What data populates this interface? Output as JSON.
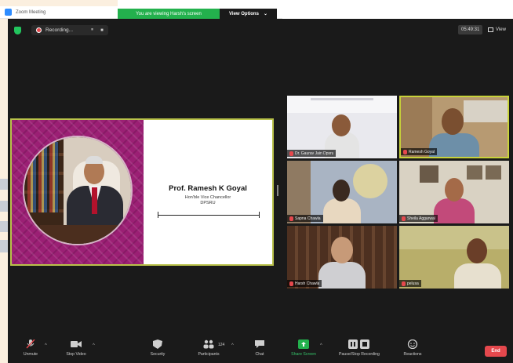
{
  "window": {
    "title": "Zoom Meeting"
  },
  "share_banner": {
    "status": "You are viewing Harsh's screen",
    "view_options_label": "View Options",
    "view_options_caret": "⌄"
  },
  "topbar": {
    "recording_label": "Recording...",
    "pause_glyph": "⏸",
    "stop_glyph": "■",
    "timer": "05:49:31",
    "view_label": "View"
  },
  "slide": {
    "name": "Prof. Ramesh K Goyal",
    "role_line1": "Hon'ble Vice Chancellor",
    "role_line2": "DPSRU"
  },
  "participants": [
    {
      "name": "Dr. Gaurav Jain Dpsru"
    },
    {
      "name": "Ramesh Goyal"
    },
    {
      "name": "Sapna Chawla"
    },
    {
      "name": "Sheila Aggarwal"
    },
    {
      "name": "Harsh Chawla"
    },
    {
      "name": "pelusa"
    }
  ],
  "toolbar": {
    "unmute": "Unmute",
    "stop_video": "Stop Video",
    "security": "Security",
    "participants": "Participants",
    "participants_count": "124",
    "chat": "Chat",
    "share_screen": "Share Screen",
    "pause_recording": "Pause/Stop Recording",
    "reactions": "Reactions",
    "end": "End",
    "caret": "^"
  },
  "colors": {
    "share_green": "#23b14d",
    "end_red": "#e5484d",
    "active_speaker_border": "#c8d23a",
    "slide_magenta": "#9b1f74"
  }
}
